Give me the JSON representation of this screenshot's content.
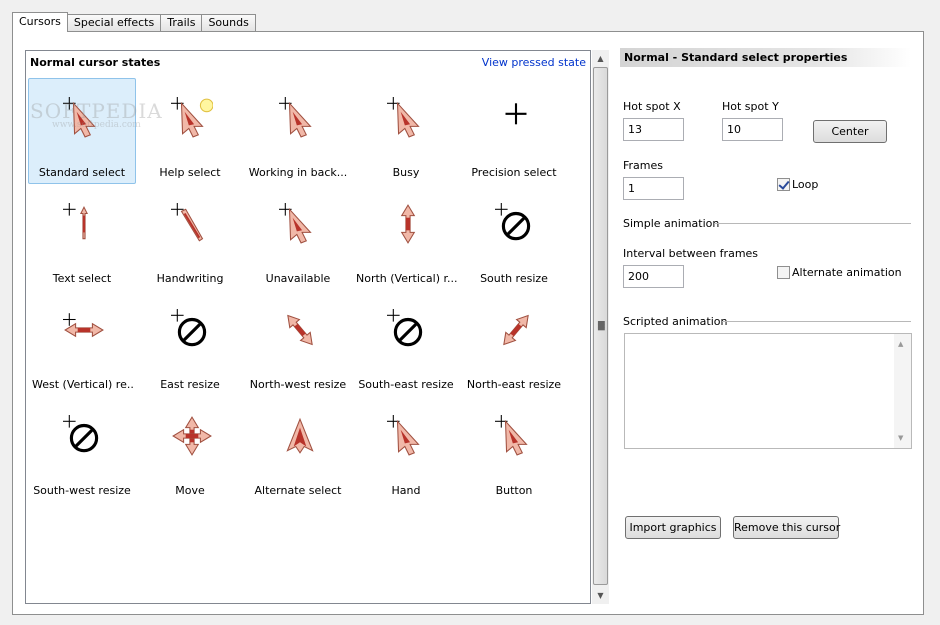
{
  "tabs": [
    {
      "label": "Cursors",
      "active": true
    },
    {
      "label": "Special effects",
      "active": false
    },
    {
      "label": "Trails",
      "active": false
    },
    {
      "label": "Sounds",
      "active": false
    }
  ],
  "list": {
    "title": "Normal cursor states",
    "view_pressed_link": "View pressed state",
    "watermark": "SOFTPEDIA",
    "watermark_url": "www.softpedia.com",
    "items": [
      {
        "label": "Standard select",
        "icon": "arrow-cursor-icon",
        "selected": true
      },
      {
        "label": "Help select",
        "icon": "help-cursor-icon"
      },
      {
        "label": "Working in back...",
        "icon": "working-cursor-icon"
      },
      {
        "label": "Busy",
        "icon": "busy-cursor-icon"
      },
      {
        "label": "Precision select",
        "icon": "crosshair-icon"
      },
      {
        "label": "Text select",
        "icon": "text-cursor-icon"
      },
      {
        "label": "Handwriting",
        "icon": "pen-cursor-icon"
      },
      {
        "label": "Unavailable",
        "icon": "unavailable-cursor-icon"
      },
      {
        "label": "North (Vertical) r...",
        "icon": "vertical-resize-icon"
      },
      {
        "label": "South resize",
        "icon": "no-cursor-icon"
      },
      {
        "label": "West (Vertical) re...",
        "icon": "horizontal-resize-icon"
      },
      {
        "label": "East resize",
        "icon": "no-cursor-icon"
      },
      {
        "label": "North-west resize",
        "icon": "diagonal-nw-resize-icon"
      },
      {
        "label": "South-east resize",
        "icon": "no-cursor-icon"
      },
      {
        "label": "North-east resize",
        "icon": "diagonal-ne-resize-icon"
      },
      {
        "label": "South-west resize",
        "icon": "no-cursor-icon"
      },
      {
        "label": "Move",
        "icon": "move-cursor-icon"
      },
      {
        "label": "Alternate select",
        "icon": "up-arrow-cursor-icon"
      },
      {
        "label": "Hand",
        "icon": "hand-cursor-icon"
      },
      {
        "label": "Button",
        "icon": "button-cursor-icon"
      }
    ]
  },
  "props": {
    "title": "Normal - Standard select properties",
    "hotspot_x_label": "Hot spot X",
    "hotspot_x_value": "13",
    "hotspot_y_label": "Hot spot Y",
    "hotspot_y_value": "10",
    "center_button": "Center",
    "frames_label": "Frames",
    "frames_value": "1",
    "loop_label": "Loop",
    "loop_checked": true,
    "simple_animation_label": "Simple animation",
    "interval_label": "Interval between frames",
    "interval_value": "200",
    "alternate_label": "Alternate animation",
    "alternate_checked": false,
    "scripted_label": "Scripted animation",
    "import_button": "Import graphics",
    "remove_button": "Remove this cursor"
  },
  "colors": {
    "accent_blue": "#0033cc",
    "selection_bg": "#dceefb",
    "cursor_red": "#b8332a",
    "cursor_pink": "#f1b8a8"
  }
}
